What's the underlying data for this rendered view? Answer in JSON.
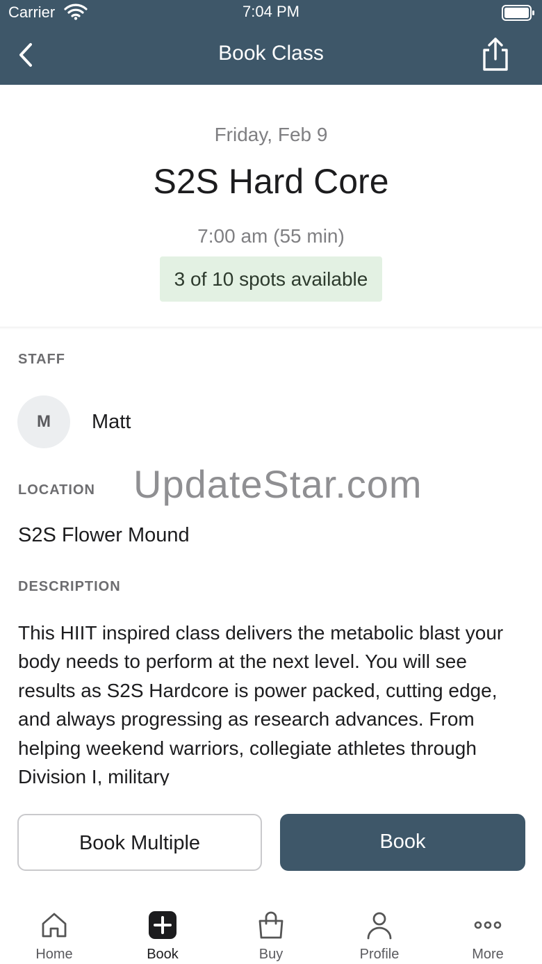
{
  "status_bar": {
    "carrier": "Carrier",
    "time": "7:04 PM"
  },
  "nav": {
    "title": "Book Class",
    "back_icon": "chevron-left-icon",
    "share_icon": "share-icon"
  },
  "class": {
    "date": "Friday, Feb 9",
    "title": "S2S Hard Core",
    "time": "7:00 am (55 min)",
    "spots": "3 of 10 spots available"
  },
  "staff": {
    "label": "STAFF",
    "initial": "M",
    "name": "Matt"
  },
  "location": {
    "label": "LOCATION",
    "name": "S2S Flower Mound"
  },
  "watermark": "UpdateStar.com",
  "description": {
    "label": "DESCRIPTION",
    "text": "This HIIT inspired class delivers the metabolic blast your body needs to perform at the next level. You will see results as S2S Hardcore is power packed, cutting edge, and always progressing as research advances. From helping weekend warriors, collegiate athletes through Division I, military"
  },
  "actions": {
    "book_multiple": "Book Multiple",
    "book": "Book"
  },
  "tabbar": {
    "items": [
      {
        "label": "Home",
        "icon": "home-icon"
      },
      {
        "label": "Book",
        "icon": "plus-square-icon",
        "active": true
      },
      {
        "label": "Buy",
        "icon": "shopping-bag-icon"
      },
      {
        "label": "Profile",
        "icon": "person-icon"
      },
      {
        "label": "More",
        "icon": "more-dots-icon"
      }
    ]
  },
  "colors": {
    "header": "#3e5769",
    "spots_bg": "#e3f1e3",
    "primary_button": "#3e5769"
  }
}
